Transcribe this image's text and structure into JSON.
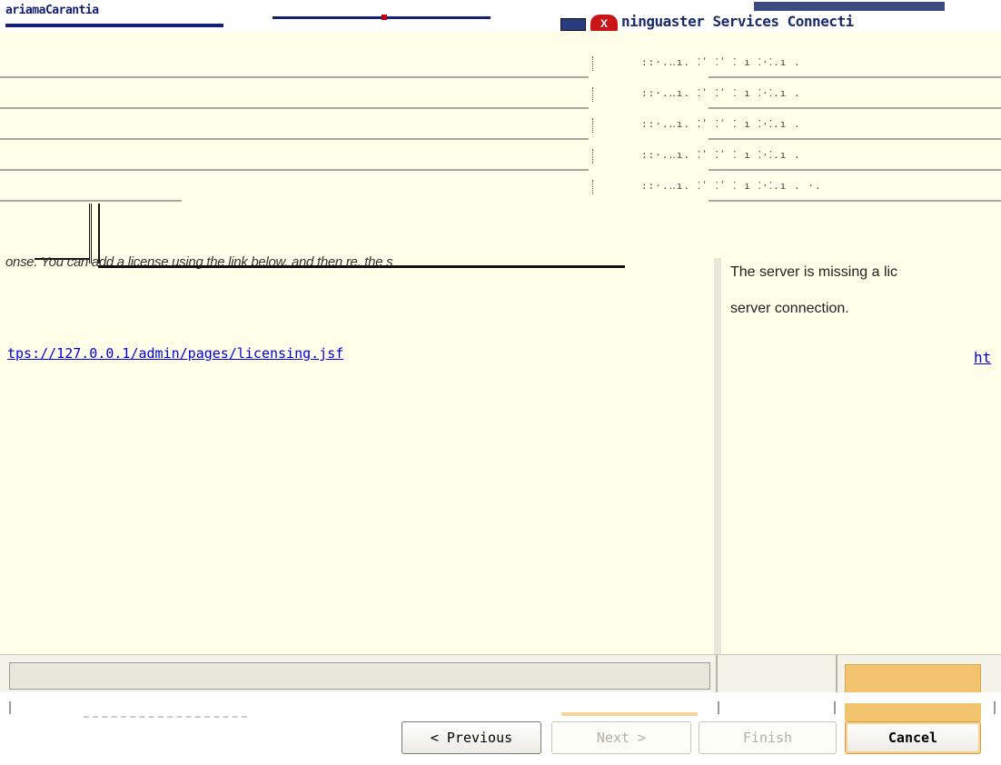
{
  "titlebar": {
    "left_text": "ariamaCarantia",
    "error_icon_glyph": "X",
    "right_text": "ninguaster Services Connecti",
    "icon_names": [
      "window-icon",
      "error-icon"
    ]
  },
  "details": {
    "rows": [
      {
        "value": "::·.‥ı. ⁚ʹ ⁚ʹ ⁚ ı    ⁚·⁚.ı ."
      },
      {
        "value": "::·.‥ı. ⁚ʹ ⁚ʹ ⁚ ı    ⁚·⁚.ı ."
      },
      {
        "value": "::·.‥ı. ⁚ʹ ⁚ʹ ⁚ ı    ⁚·⁚.ı ."
      },
      {
        "value": "::·.‥ı. ⁚ʹ ⁚ʹ ⁚ ı    ⁚·⁚.ı ."
      },
      {
        "value": "::·.‥ı. ⁚ʹ ⁚ʹ ⁚ ı    ⁚·⁚.ı . ·."
      }
    ]
  },
  "message": {
    "left_text": "onse. You can add a license using the link below, and then re, the s",
    "right_line1": "The server is missing a lic",
    "right_line2": "server connection.",
    "license_url": "tps://127.0.0.1/admin/pages/licensing.jsf",
    "license_url_right": "ht"
  },
  "buttons": {
    "previous": "< Previous",
    "next": "Next >",
    "finish": "Finish",
    "cancel": "Cancel"
  },
  "colors": {
    "content_bg": "#fefee9",
    "link": "#0000e0",
    "accent": "#f2c46d",
    "title": "#12207a"
  }
}
